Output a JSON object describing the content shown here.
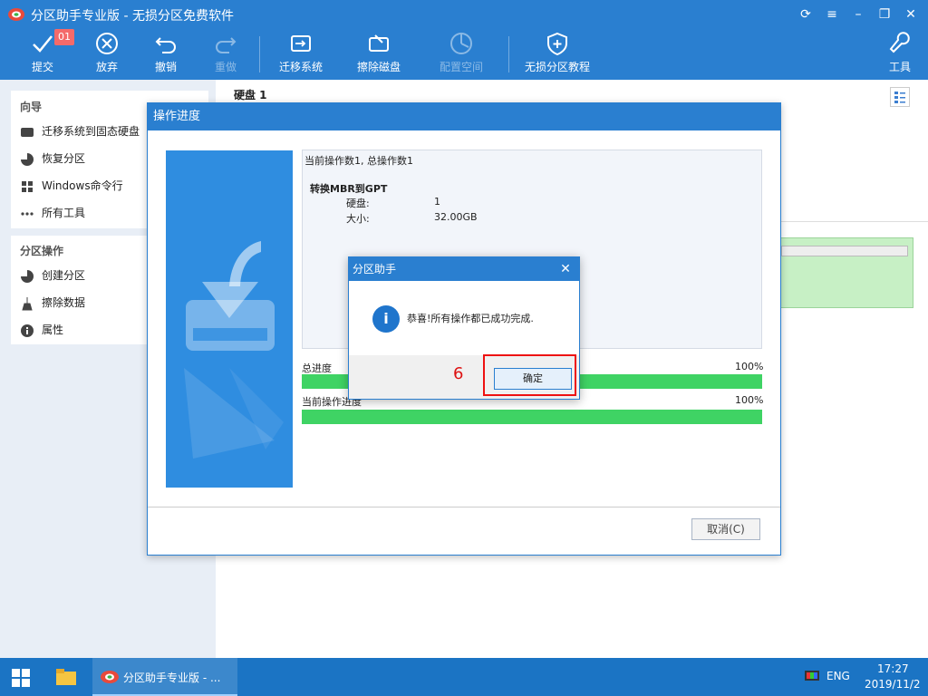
{
  "window": {
    "title": "分区助手专业版 - 无损分区免费软件"
  },
  "toolbar": {
    "badge": "01",
    "items": [
      {
        "label": "提交"
      },
      {
        "label": "放弃"
      },
      {
        "label": "撤销"
      },
      {
        "label": "重做"
      },
      {
        "label": "迁移系统"
      },
      {
        "label": "擦除磁盘"
      },
      {
        "label": "配置空间"
      },
      {
        "label": "无损分区教程"
      },
      {
        "label": "工具"
      }
    ]
  },
  "sidebar": {
    "wizard_title": "向导",
    "wizard_items": [
      "迁移系统到固态硬盘",
      "恢复分区",
      "Windows命令行",
      "所有工具"
    ],
    "ops_title": "分区操作",
    "ops_items": [
      "创建分区",
      "擦除数据",
      "属性"
    ]
  },
  "main": {
    "disk_label": "硬盘 1"
  },
  "progress_dialog": {
    "title": "操作进度",
    "current_ops": "当前操作数1, 总操作数1",
    "op_name": "转换MBR到GPT",
    "disk_key": "硬盘:",
    "disk_val": "1",
    "size_key": "大小:",
    "size_val": "32.00GB",
    "total_label": "总进度",
    "total_pct": "100%",
    "total_progress": 1.0,
    "current_label": "当前操作进度",
    "current_pct": "100%",
    "current_progress": 1.0,
    "cancel_label": "取消(C)"
  },
  "message_box": {
    "title": "分区助手",
    "text": "恭喜!所有操作都已成功完成.",
    "ok_label": "确定"
  },
  "annotation": {
    "step": "6"
  },
  "taskbar": {
    "app_label": "分区助手专业版 - ...",
    "lang": "ENG",
    "time": "17:27",
    "date": "2019/11/2"
  }
}
